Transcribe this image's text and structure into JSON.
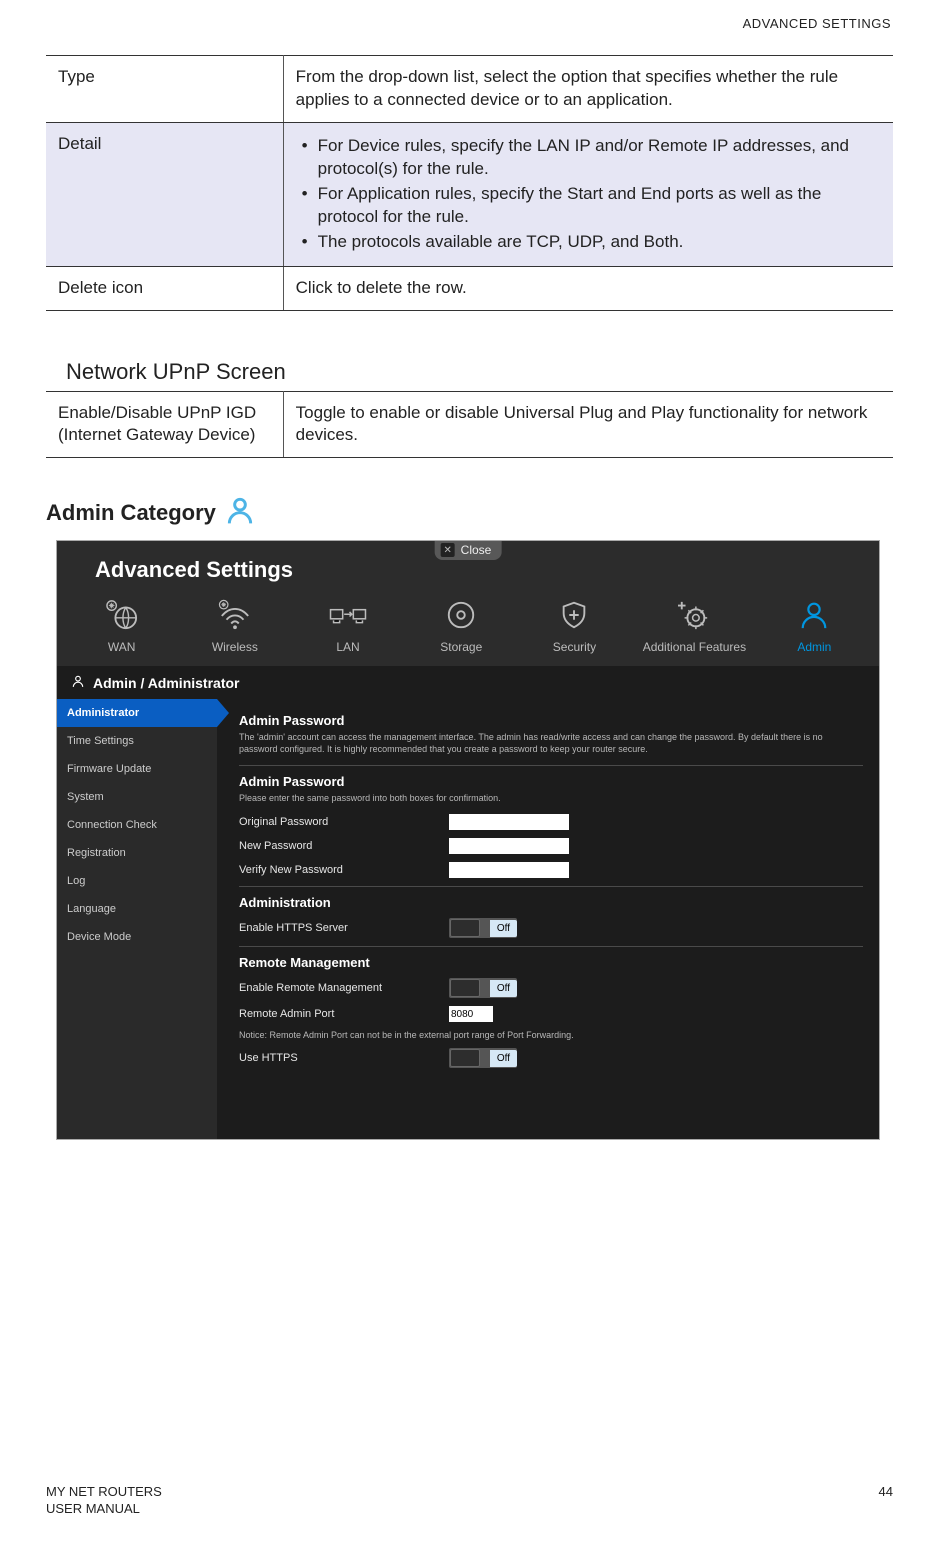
{
  "header": "ADVANCED SETTINGS",
  "table1": {
    "rows": [
      {
        "label": "Type",
        "desc": "From the drop-down list, select the option that specifies whether the rule applies to a connected device or to an application."
      },
      {
        "label": "Detail",
        "bullets": [
          "For Device rules, specify the LAN IP and/or Remote IP addresses, and protocol(s) for the rule.",
          "For Application rules, specify the Start and End ports as well as the protocol for the rule.",
          "The protocols available are TCP, UDP, and Both."
        ],
        "shaded": true
      },
      {
        "label": "Delete icon",
        "desc": "Click to delete the row."
      }
    ]
  },
  "upnp": {
    "title": "Network UPnP Screen",
    "row": {
      "label": "Enable/Disable UPnP IGD (Internet Gateway Device)",
      "desc": "Toggle to enable or disable Universal Plug and Play functionality for network devices."
    }
  },
  "admin_heading": "Admin Category",
  "shot": {
    "close": "Close",
    "title": "Advanced Settings",
    "tabs": [
      "WAN",
      "Wireless",
      "LAN",
      "Storage",
      "Security",
      "Additional Features",
      "Admin"
    ],
    "active_tab": 6,
    "breadcrumb": "Admin / Administrator",
    "sidebar": [
      "Administrator",
      "Time Settings",
      "Firmware Update",
      "System",
      "Connection Check",
      "Registration",
      "Log",
      "Language",
      "Device Mode"
    ],
    "sidebar_active": 0,
    "block1": {
      "title": "Admin Password",
      "desc": "The 'admin' account can access the management interface. The admin has read/write access and can change the password. By default there is no password configured. It is highly recommended that you create a password to keep your router secure."
    },
    "block2": {
      "title": "Admin Password",
      "desc": "Please enter the same password into both boxes for confirmation.",
      "fields": [
        "Original Password",
        "New Password",
        "Verify New Password"
      ]
    },
    "block3": {
      "title": "Administration",
      "field": "Enable HTTPS Server",
      "toggle": "Off"
    },
    "block4": {
      "title": "Remote Management",
      "f1": "Enable Remote Management",
      "t1": "Off",
      "f2": "Remote Admin Port",
      "v2": "8080",
      "notice": "Notice: Remote Admin Port can not be in the external port range of Port Forwarding.",
      "f3": "Use HTTPS",
      "t3": "Off"
    }
  },
  "footer": {
    "left1": "MY NET ROUTERS",
    "left2": "USER MANUAL",
    "page": "44"
  }
}
